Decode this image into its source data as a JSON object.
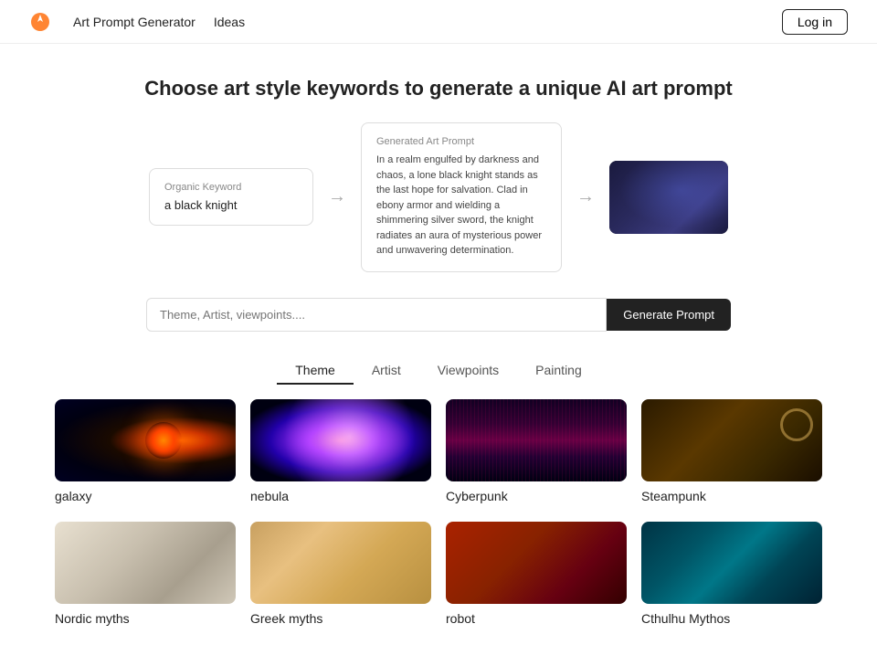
{
  "nav": {
    "links": [
      {
        "label": "Art Prompt Generator"
      },
      {
        "label": "Ideas"
      }
    ],
    "login_label": "Log in"
  },
  "hero": {
    "title": "Choose art style keywords to generate a unique AI art prompt"
  },
  "demo": {
    "organic_keyword_label": "Organic Keyword",
    "organic_keyword_value": "a black knight",
    "generated_prompt_label": "Generated Art Prompt",
    "generated_prompt_value": "In a realm engulfed by darkness and chaos, a lone black knight stands as the last hope for salvation. Clad in ebony armor and wielding a shimmering silver sword, the knight radiates an aura of mysterious power and unwavering determination."
  },
  "search": {
    "placeholder": "Theme, Artist, viewpoints....",
    "button_label": "Generate Prompt"
  },
  "tabs": [
    {
      "label": "Theme",
      "active": true
    },
    {
      "label": "Artist",
      "active": false
    },
    {
      "label": "Viewpoints",
      "active": false
    },
    {
      "label": "Painting",
      "active": false
    }
  ],
  "grid": [
    {
      "label": "galaxy",
      "img_class": "img-galaxy"
    },
    {
      "label": "nebula",
      "img_class": "img-nebula"
    },
    {
      "label": "Cyberpunk",
      "img_class": "img-cyberpunk"
    },
    {
      "label": "Steampunk",
      "img_class": "img-steampunk"
    },
    {
      "label": "Nordic myths",
      "img_class": "img-nordic"
    },
    {
      "label": "Greek myths",
      "img_class": "img-greek"
    },
    {
      "label": "robot",
      "img_class": "img-robot"
    },
    {
      "label": "Cthulhu Mythos",
      "img_class": "img-cthulhu"
    }
  ]
}
